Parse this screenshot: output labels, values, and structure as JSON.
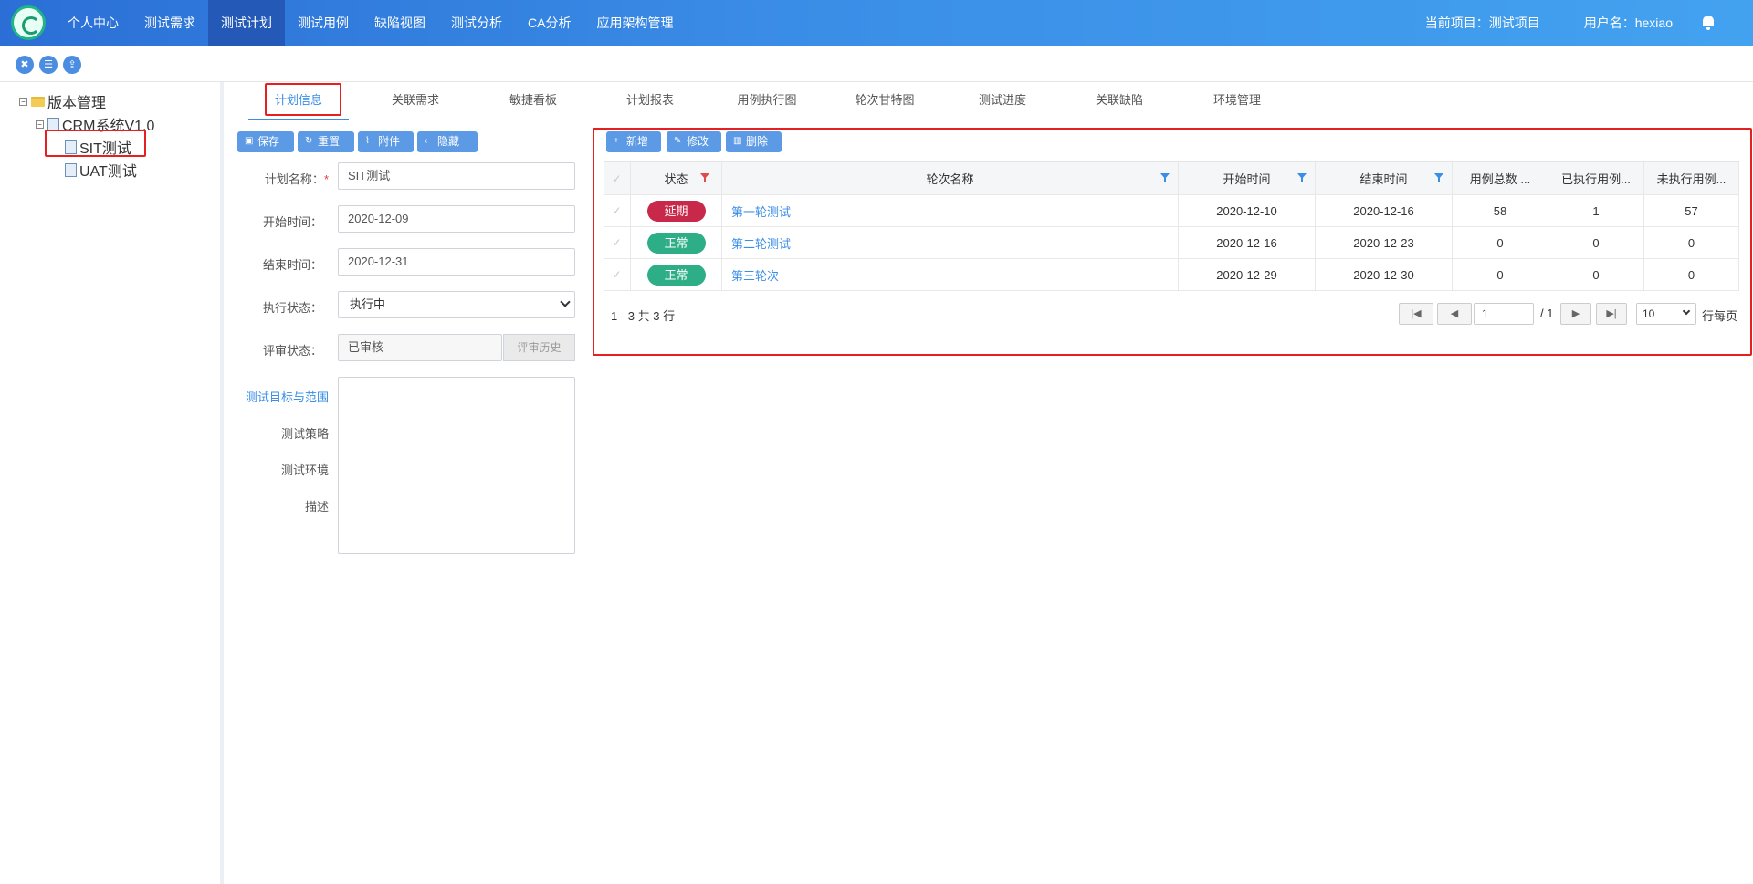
{
  "nav": {
    "items": [
      "个人中心",
      "测试需求",
      "测试计划",
      "测试用例",
      "缺陷视图",
      "测试分析",
      "CA分析",
      "应用架构管理"
    ],
    "active_index": 2,
    "current_project": "当前项目：测试项目",
    "username": "用户名：hexiao"
  },
  "toolbar_icons": [
    "trash-icon",
    "list-icon",
    "export-icon"
  ],
  "tree": {
    "root": "版本管理",
    "version": "CRM系统V1.0",
    "plans": [
      "SIT测试",
      "UAT测试"
    ],
    "selected": "SIT测试"
  },
  "tabs": [
    "计划信息",
    "关联需求",
    "敏捷看板",
    "计划报表",
    "用例执行图",
    "轮次甘特图",
    "测试进度",
    "关联缺陷",
    "环境管理"
  ],
  "form": {
    "buttons": {
      "save": "保存",
      "reset": "重置",
      "attach": "附件",
      "hide": "隐藏"
    },
    "plan_name_label": "计划名称：",
    "required_mark": "*",
    "plan_name": "SIT测试",
    "start_label": "开始时间：",
    "start": "2020-12-09",
    "end_label": "结束时间：",
    "end": "2020-12-31",
    "exec_label": "执行状态：",
    "exec_status": "执行中",
    "review_label": "评审状态：",
    "review_status": "已审核",
    "review_history": "评审历史",
    "sections": [
      "测试目标与范围",
      "测试策略",
      "测试环境",
      "描述"
    ]
  },
  "grid": {
    "buttons": {
      "add": "新增",
      "edit": "修改",
      "delete": "删除"
    },
    "columns": [
      "状态",
      "轮次名称",
      "开始时间",
      "结束时间",
      "用例总数 ...",
      "已执行用例...",
      "未执行用例..."
    ],
    "rows": [
      {
        "status": "延期",
        "status_color": "#c8284a",
        "name": "第一轮测试",
        "start": "2020-12-10",
        "end": "2020-12-16",
        "total": "58",
        "executed": "1",
        "pending": "57"
      },
      {
        "status": "正常",
        "status_color": "#2eae86",
        "name": "第二轮测试",
        "start": "2020-12-16",
        "end": "2020-12-23",
        "total": "0",
        "executed": "0",
        "pending": "0"
      },
      {
        "status": "正常",
        "status_color": "#2eae86",
        "name": "第三轮次",
        "start": "2020-12-29",
        "end": "2020-12-30",
        "total": "0",
        "executed": "0",
        "pending": "0"
      }
    ],
    "pager": {
      "summary": "1 - 3 共 3 行",
      "page": "1",
      "total_pages": "/ 1",
      "page_size": "10",
      "per_page_label": "行每页"
    }
  }
}
